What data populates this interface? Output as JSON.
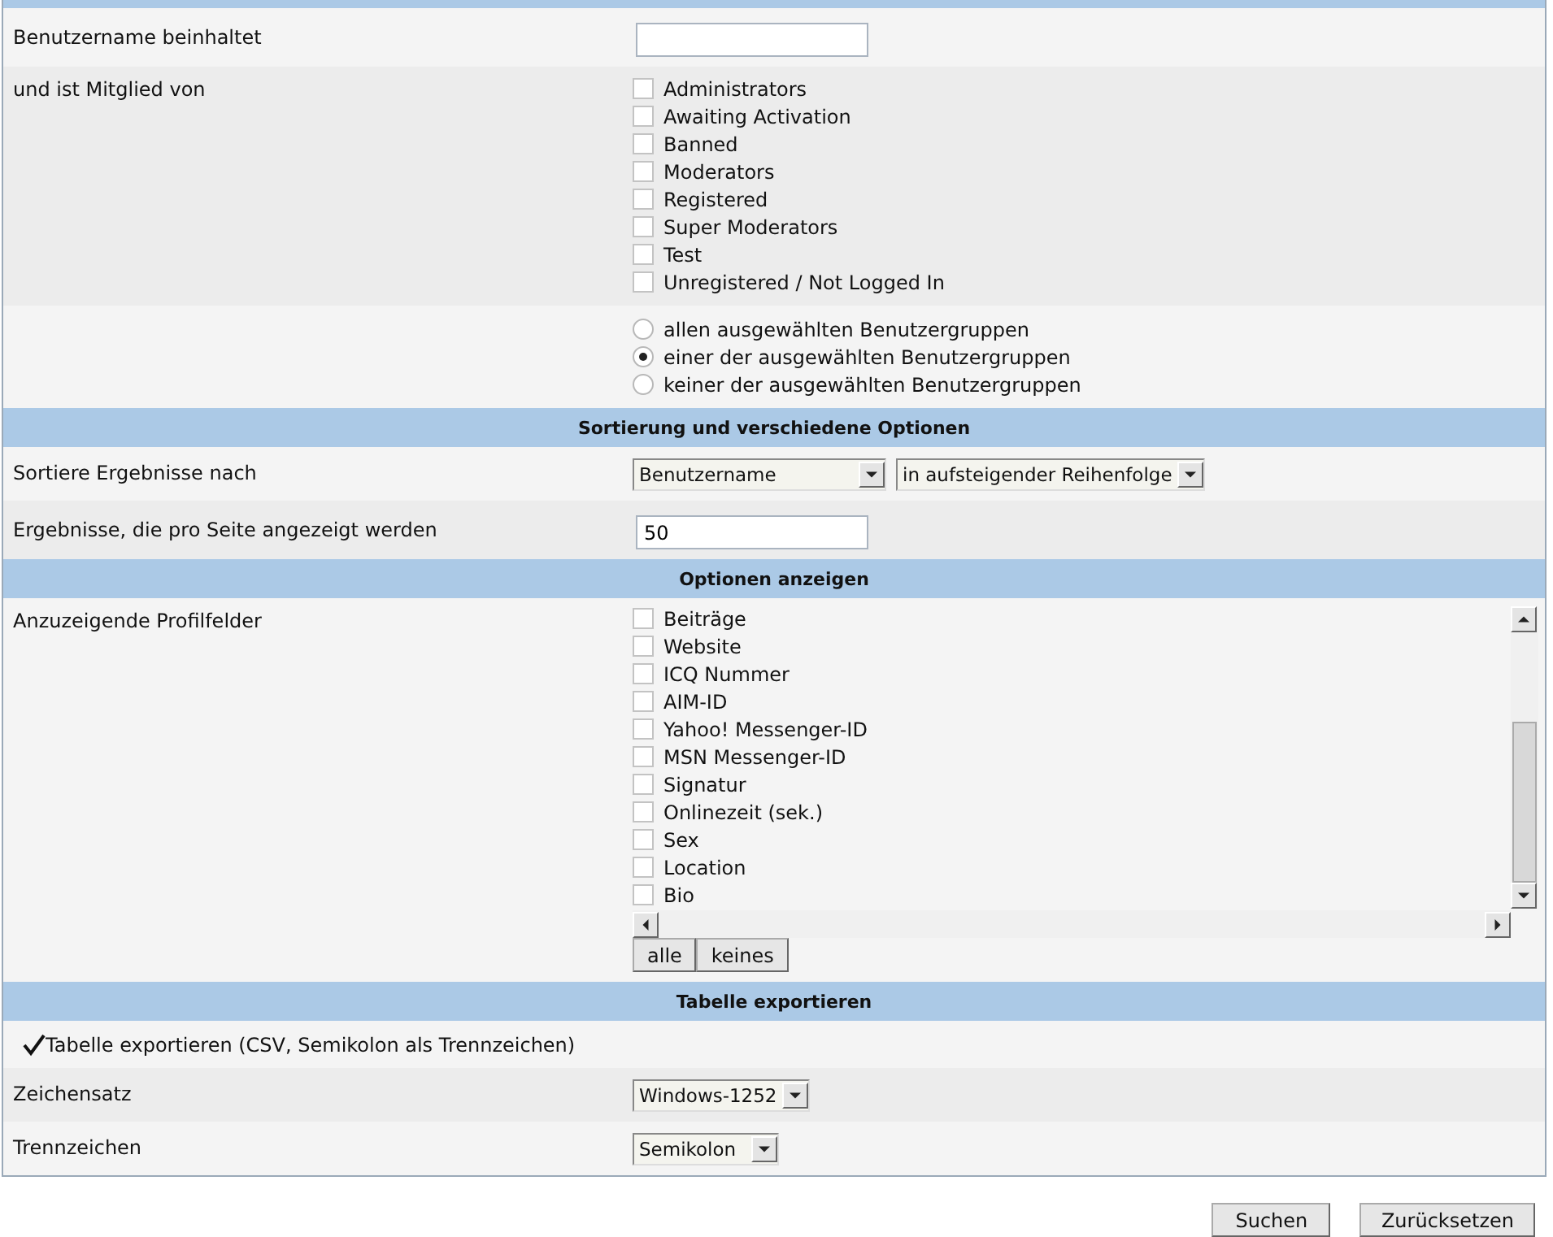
{
  "sections": [
    {
      "rows": [
        {
          "kind": "text",
          "label": "Benutzername beinhaltet"
        },
        {
          "kind": "checkboxes",
          "label": "und ist Mitglied von",
          "options": [
            {
              "label": "Administrators",
              "checked": false
            },
            {
              "label": "Awaiting Activation",
              "checked": false
            },
            {
              "label": "Banned",
              "checked": false
            },
            {
              "label": "Moderators",
              "checked": false
            },
            {
              "label": "Registered",
              "checked": false
            },
            {
              "label": "Super Moderators",
              "checked": false
            },
            {
              "label": "Test",
              "checked": false
            },
            {
              "label": "Unregistered / Not Logged In",
              "checked": false
            }
          ]
        },
        {
          "kind": "radios",
          "options": [
            {
              "label": "allen ausgewählten Benutzergruppen",
              "selected": false
            },
            {
              "label": "einer der ausgewählten Benutzergruppen",
              "selected": true
            },
            {
              "label": "keiner der ausgewählten Benutzergruppen",
              "selected": false
            }
          ]
        }
      ]
    },
    {
      "title": "Sortierung und verschiedene Optionen",
      "rows": [
        {
          "kind": "selects",
          "label": "Sortiere Ergebnisse nach",
          "selects": [
            "Benutzername",
            "in aufsteigender Reihenfolge"
          ]
        },
        {
          "kind": "text",
          "label": "Ergebnisse, die pro Seite angezeigt werden",
          "value": "50"
        }
      ]
    },
    {
      "title": "Optionen anzeigen",
      "rows": [
        {
          "kind": "scrolllist",
          "label": "Anzuzeigende Profilfelder",
          "options": [
            {
              "label": "Beiträge",
              "checked": false
            },
            {
              "label": "Website",
              "checked": false
            },
            {
              "label": "ICQ Nummer",
              "checked": false
            },
            {
              "label": "AIM-ID",
              "checked": false
            },
            {
              "label": "Yahoo! Messenger-ID",
              "checked": false
            },
            {
              "label": "MSN Messenger-ID",
              "checked": false
            },
            {
              "label": "Signatur",
              "checked": false
            },
            {
              "label": "Onlinezeit (sek.)",
              "checked": false
            },
            {
              "label": "Sex",
              "checked": false
            },
            {
              "label": "Location",
              "checked": false
            },
            {
              "label": "Bio",
              "checked": false
            }
          ],
          "buttons": [
            "alle",
            "keines"
          ]
        }
      ]
    },
    {
      "title": "Tabelle exportieren",
      "rows": [
        {
          "kind": "check",
          "label": "Tabelle exportieren (CSV, Semikolon als Trennzeichen)",
          "checked": true
        },
        {
          "kind": "selects",
          "label": "Zeichensatz",
          "selects": [
            "Windows-1252"
          ]
        },
        {
          "kind": "selects",
          "label": "Trennzeichen",
          "selects": [
            "Semikolon"
          ]
        }
      ]
    }
  ],
  "actions": [
    "Suchen",
    "Zurücksetzen"
  ]
}
